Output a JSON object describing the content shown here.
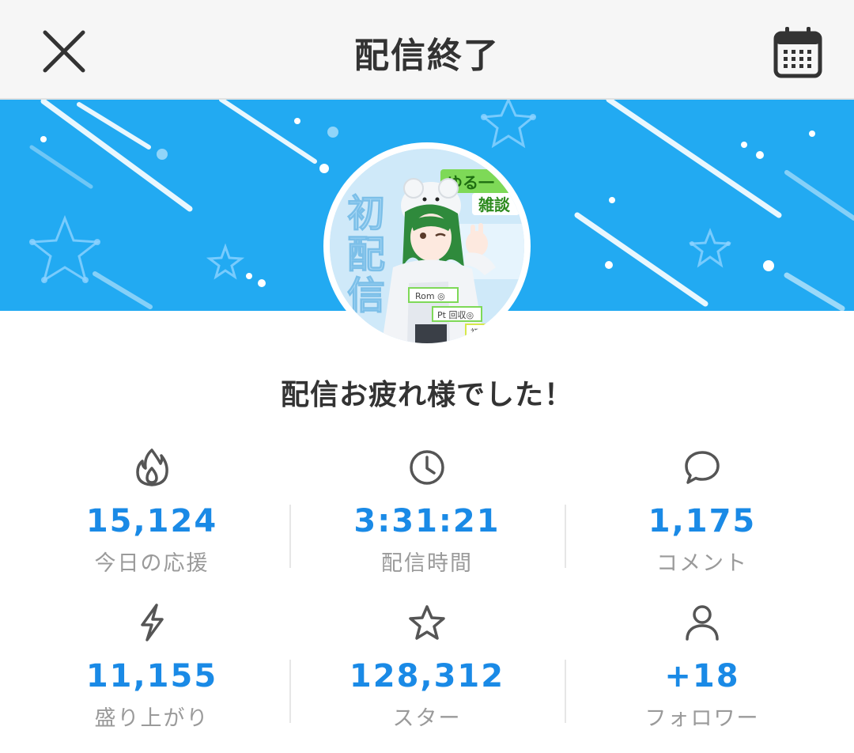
{
  "header": {
    "title": "配信終了",
    "close_icon": "close-icon",
    "calendar_icon": "calendar-icon"
  },
  "banner": {
    "background_color": "#22aaf2"
  },
  "avatar": {
    "overlay_texts": {
      "title_vertical": "初配信",
      "badge_top": "ゆる一",
      "badge_bottom": "雑談",
      "tag_rom": "Rom ◎",
      "tag_pt": "Pt 回収◎",
      "tag_first": "初見"
    }
  },
  "message": "配信お疲れ様でした！",
  "stats": [
    {
      "icon": "fire-icon",
      "value": "15,124",
      "label": "今日の応援"
    },
    {
      "icon": "clock-icon",
      "value": "3:31:21",
      "label": "配信時間"
    },
    {
      "icon": "comment-icon",
      "value": "1,175",
      "label": "コメント"
    },
    {
      "icon": "lightning-icon",
      "value": "11,155",
      "label": "盛り上がり"
    },
    {
      "icon": "star-icon",
      "value": "128,312",
      "label": "スター"
    },
    {
      "icon": "person-icon",
      "value": "+18",
      "label": "フォロワー"
    }
  ],
  "colors": {
    "accent": "#1a8ae6",
    "label": "#9a9a9a",
    "header_bg": "#f6f6f6"
  }
}
